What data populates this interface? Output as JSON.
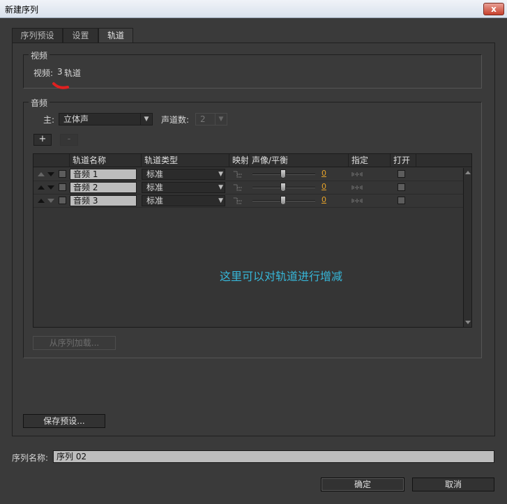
{
  "window": {
    "title": "新建序列",
    "close_glyph": "x"
  },
  "tabs": [
    {
      "label": "序列预设"
    },
    {
      "label": "设置"
    },
    {
      "label": "轨道"
    }
  ],
  "video": {
    "group_label": "视频",
    "label": "视频:",
    "count": "3",
    "unit": "轨道"
  },
  "audio": {
    "group_label": "音频",
    "master_label": "主:",
    "master_value": "立体声",
    "channels_label": "声道数:",
    "channels_value": "2",
    "add_label": "+",
    "remove_label": "-",
    "columns": [
      "轨道名称",
      "轨道类型",
      "映射",
      "声像/平衡",
      "指定",
      "打开"
    ],
    "tracks": [
      {
        "name": "音频 1",
        "type": "标准",
        "pan": "0"
      },
      {
        "name": "音频 2",
        "type": "标准",
        "pan": "0"
      },
      {
        "name": "音频 3",
        "type": "标准",
        "pan": "0"
      }
    ],
    "annotation": "这里可以对轨道进行增减",
    "load_from_sequence_label": "从序列加载..."
  },
  "save_preset_label": "保存预设...",
  "sequence_name": {
    "label": "序列名称:",
    "value": "序列 02"
  },
  "ok_label": "确定",
  "cancel_label": "取消",
  "colors": {
    "accent": "#e5a22a",
    "annotation": "#36b7d9",
    "panel": "#3a3a3a"
  }
}
